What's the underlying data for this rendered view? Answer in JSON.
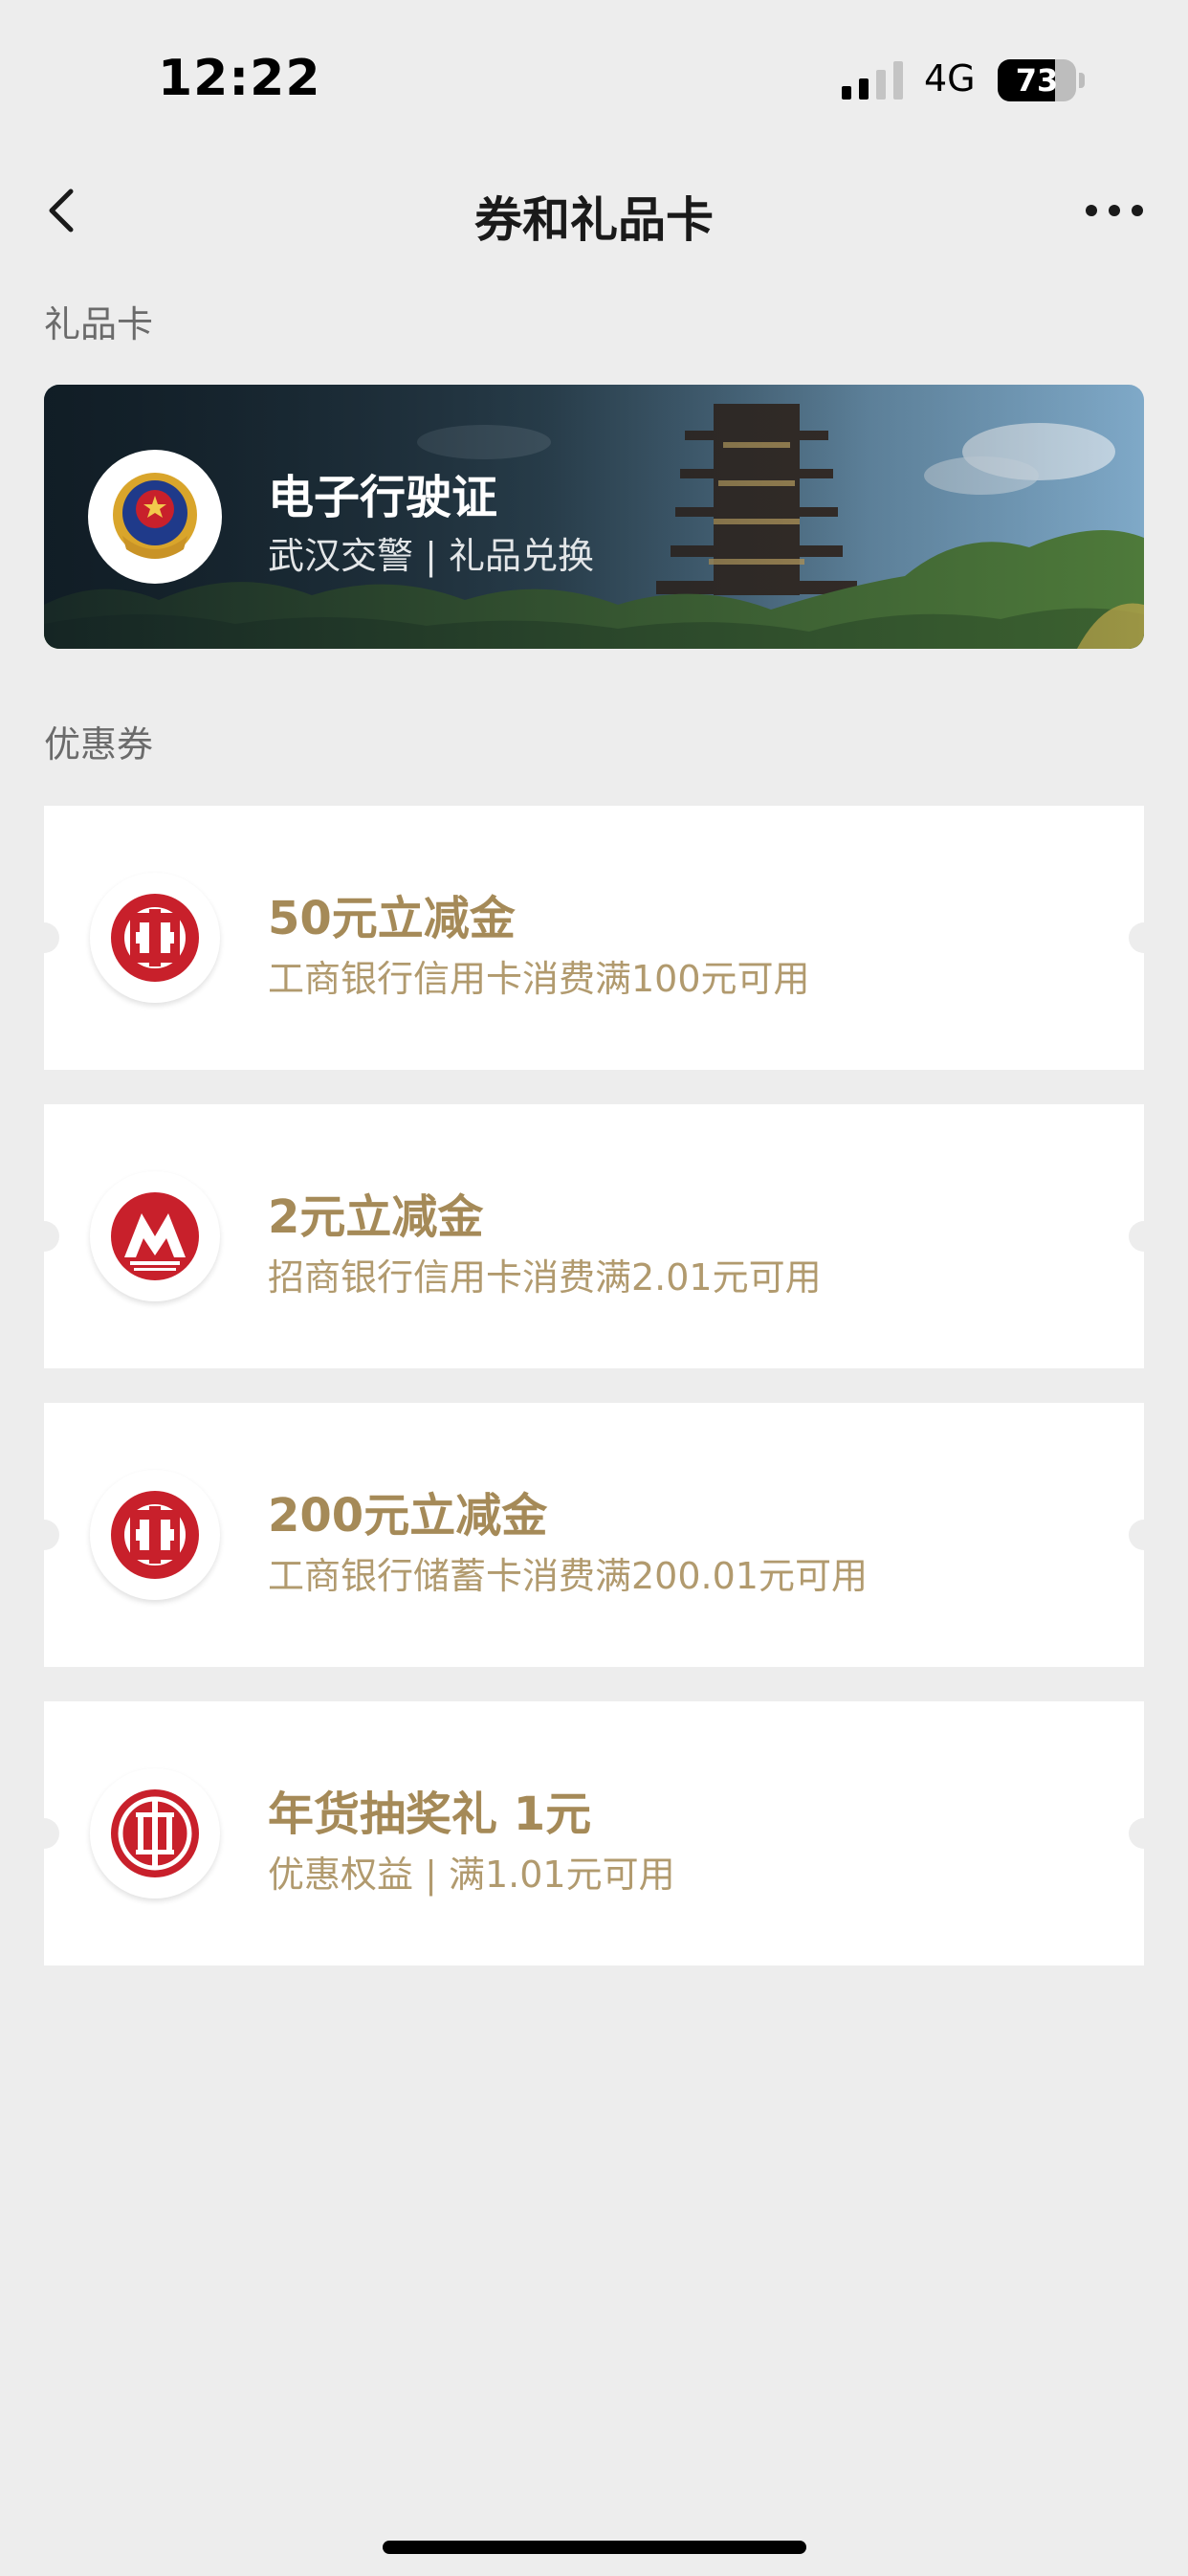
{
  "status_bar": {
    "time": "12:22",
    "network": "4G",
    "battery_percent": 73,
    "battery_label": "73"
  },
  "nav": {
    "title": "券和礼品卡",
    "back_icon": "chevron-left-icon",
    "more_icon": "ellipsis-icon"
  },
  "gift_section": {
    "label": "礼品卡",
    "card": {
      "title": "电子行驶证",
      "subtitle": "武汉交警 | 礼品兑换",
      "logo_icon": "police-badge-icon"
    }
  },
  "coupon_section": {
    "label": "优惠券",
    "coupons": [
      {
        "title": "50元立减金",
        "desc": "工商银行信用卡消费满100元可用",
        "logo_icon": "icbc-logo-icon"
      },
      {
        "title": "2元立减金",
        "desc": "招商银行信用卡消费满2.01元可用",
        "logo_icon": "cmb-logo-icon"
      },
      {
        "title": "200元立减金",
        "desc": "工商银行储蓄卡消费满200.01元可用",
        "logo_icon": "icbc-logo-icon"
      },
      {
        "title": "年货抽奖礼 1元",
        "desc": "优惠权益 | 满1.01元可用",
        "logo_icon": "citic-logo-icon"
      }
    ]
  },
  "colors": {
    "coupon_text": "#a58a58",
    "brand_red": "#c8202b",
    "background": "#ededed"
  }
}
